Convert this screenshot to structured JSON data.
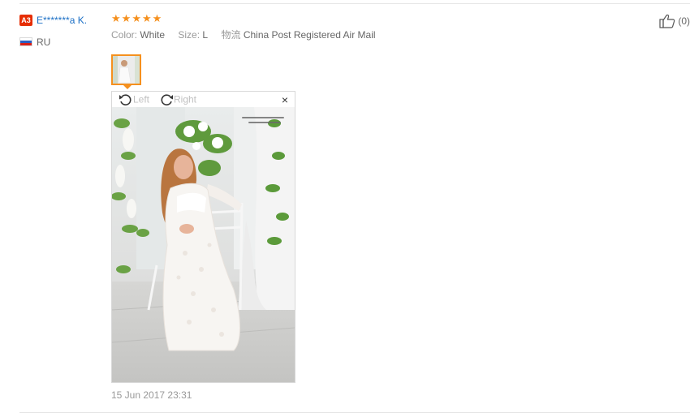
{
  "review": {
    "user": {
      "level_badge": "A3",
      "name": "E*******a K.",
      "country_code": "RU",
      "flag_icon": "russia-flag-icon"
    },
    "rating": {
      "stars": 5,
      "max": 5,
      "color": "#f5901e"
    },
    "attributes": [
      {
        "key": "Color:",
        "value": "White"
      },
      {
        "key": "Size:",
        "value": "L"
      },
      {
        "key": "物流",
        "value": "China Post Registered Air Mail"
      }
    ],
    "viewer": {
      "rotate_left_label": "Left",
      "rotate_right_label": "Right",
      "rotate_left_icon": "rotate-left-icon",
      "rotate_right_icon": "rotate-right-icon",
      "close_icon": "close-icon",
      "close_glyph": "×",
      "photo_watermark": "Sokolova Photography"
    },
    "date": "15 Jun 2017 23:31",
    "helpful": {
      "icon": "thumbs-up-icon",
      "count": "(0)"
    }
  },
  "colors": {
    "accent": "#f5901e",
    "link": "#1b6fc5",
    "badge": "#e62e04"
  }
}
